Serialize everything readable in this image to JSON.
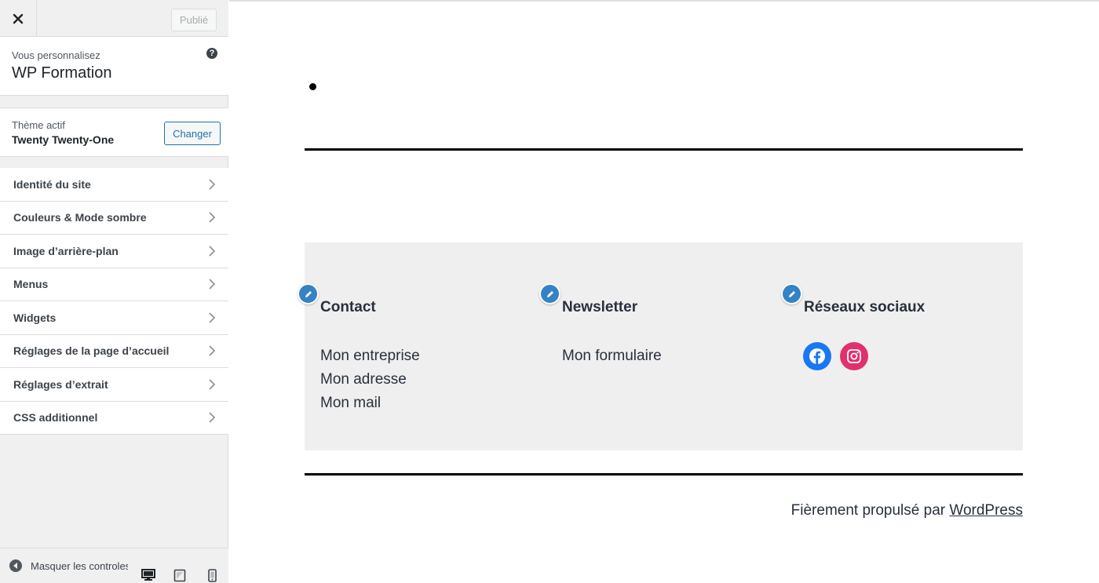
{
  "sidebar": {
    "publish_label": "Publié",
    "customizing_label": "Vous personnalisez",
    "site_title": "WP Formation",
    "active_theme_label": "Thème actif",
    "active_theme_name": "Twenty Twenty-One",
    "change_label": "Changer",
    "items": [
      {
        "label": "Identité du site"
      },
      {
        "label": "Couleurs & Mode sombre"
      },
      {
        "label": "Image d’arrière-plan"
      },
      {
        "label": "Menus"
      },
      {
        "label": "Widgets"
      },
      {
        "label": "Réglages de la page d’accueil"
      },
      {
        "label": "Réglages d’extrait"
      },
      {
        "label": "CSS additionnel"
      }
    ],
    "collapse_label": "Masquer les controles"
  },
  "preview": {
    "widgets": [
      {
        "title": "Contact",
        "lines": [
          "Mon entreprise",
          "Mon adresse",
          "Mon mail"
        ]
      },
      {
        "title": "Newsletter",
        "lines": [
          "Mon formulaire"
        ]
      },
      {
        "title": "Réseaux sociaux",
        "icons": [
          "facebook-icon",
          "instagram-icon"
        ]
      }
    ],
    "credit_text": "Fièrement propulsé par",
    "credit_link": "WordPress"
  },
  "colors": {
    "accent": "#2271b1",
    "edit_pencil": "#3582c4",
    "facebook": "#1877f2",
    "instagram": "#e1306c",
    "widgets_bg": "#efefef"
  }
}
